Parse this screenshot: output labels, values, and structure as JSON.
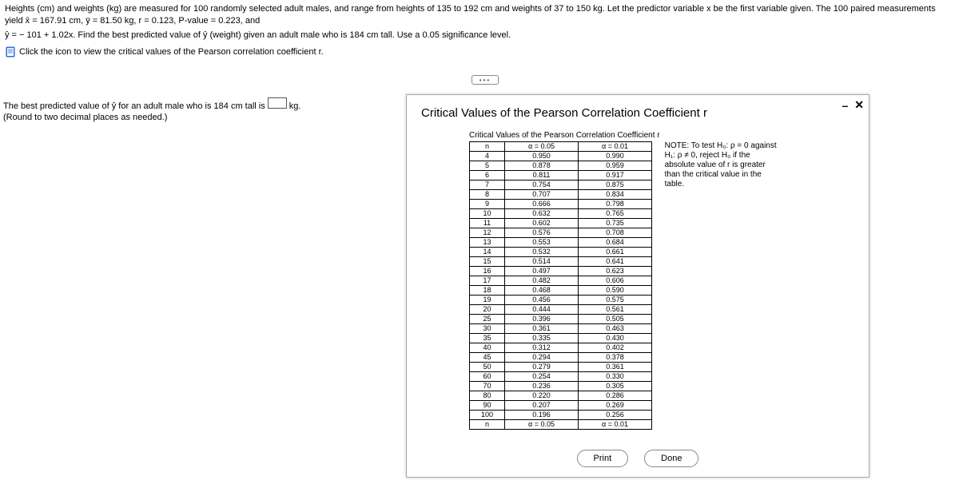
{
  "problem": {
    "line1": "Heights (cm) and weights (kg) are measured for 100 randomly selected adult males, and range from heights of 135 to 192 cm and weights of 37 to 150 kg. Let the predictor variable x be the first variable given. The 100 paired measurements yield x̄ = 167.91 cm, ȳ = 81.50 kg, r = 0.123, P-value = 0.223, and",
    "line2": "ŷ = − 101 + 1.02x. Find the best predicted value of ŷ (weight) given an adult male who is 184 cm tall. Use a 0.05 significance level.",
    "icon_link_text": "Click the icon to view the critical values of the Pearson correlation coefficient r."
  },
  "question": {
    "prefix": "The best predicted value of ŷ for an adult male who is 184 cm tall is",
    "suffix": "kg.",
    "hint": "(Round to two decimal places as needed.)"
  },
  "modal": {
    "title": "Critical Values of the Pearson Correlation Coefficient r",
    "table_caption": "Critical Values of the Pearson Correlation Coefficient r",
    "headers": {
      "n": "n",
      "a05": "α = 0.05",
      "a01": "α = 0.01"
    },
    "rows": [
      {
        "n": "4",
        "a05": "0.950",
        "a01": "0.990"
      },
      {
        "n": "5",
        "a05": "0.878",
        "a01": "0.959"
      },
      {
        "n": "6",
        "a05": "0.811",
        "a01": "0.917"
      },
      {
        "n": "7",
        "a05": "0.754",
        "a01": "0.875"
      },
      {
        "n": "8",
        "a05": "0.707",
        "a01": "0.834"
      },
      {
        "n": "9",
        "a05": "0.666",
        "a01": "0.798"
      },
      {
        "n": "10",
        "a05": "0.632",
        "a01": "0.765"
      },
      {
        "n": "11",
        "a05": "0.602",
        "a01": "0.735"
      },
      {
        "n": "12",
        "a05": "0.576",
        "a01": "0.708"
      },
      {
        "n": "13",
        "a05": "0.553",
        "a01": "0.684"
      },
      {
        "n": "14",
        "a05": "0.532",
        "a01": "0.661"
      },
      {
        "n": "15",
        "a05": "0.514",
        "a01": "0.641"
      },
      {
        "n": "16",
        "a05": "0.497",
        "a01": "0.623"
      },
      {
        "n": "17",
        "a05": "0.482",
        "a01": "0.606"
      },
      {
        "n": "18",
        "a05": "0.468",
        "a01": "0.590"
      },
      {
        "n": "19",
        "a05": "0.456",
        "a01": "0.575"
      },
      {
        "n": "20",
        "a05": "0.444",
        "a01": "0.561"
      },
      {
        "n": "25",
        "a05": "0.396",
        "a01": "0.505"
      },
      {
        "n": "30",
        "a05": "0.361",
        "a01": "0.463"
      },
      {
        "n": "35",
        "a05": "0.335",
        "a01": "0.430"
      },
      {
        "n": "40",
        "a05": "0.312",
        "a01": "0.402"
      },
      {
        "n": "45",
        "a05": "0.294",
        "a01": "0.378"
      },
      {
        "n": "50",
        "a05": "0.279",
        "a01": "0.361"
      },
      {
        "n": "60",
        "a05": "0.254",
        "a01": "0.330"
      },
      {
        "n": "70",
        "a05": "0.236",
        "a01": "0.305"
      },
      {
        "n": "80",
        "a05": "0.220",
        "a01": "0.286"
      },
      {
        "n": "90",
        "a05": "0.207",
        "a01": "0.269"
      },
      {
        "n": "100",
        "a05": "0.196",
        "a01": "0.256"
      }
    ],
    "footers": {
      "n": "n",
      "a05": "α = 0.05",
      "a01": "α = 0.01"
    },
    "note": "NOTE: To test H₀: ρ = 0 against H₁: ρ ≠ 0, reject H₀ if the absolute value of r is greater than the critical value in the table.",
    "print": "Print",
    "done": "Done"
  }
}
